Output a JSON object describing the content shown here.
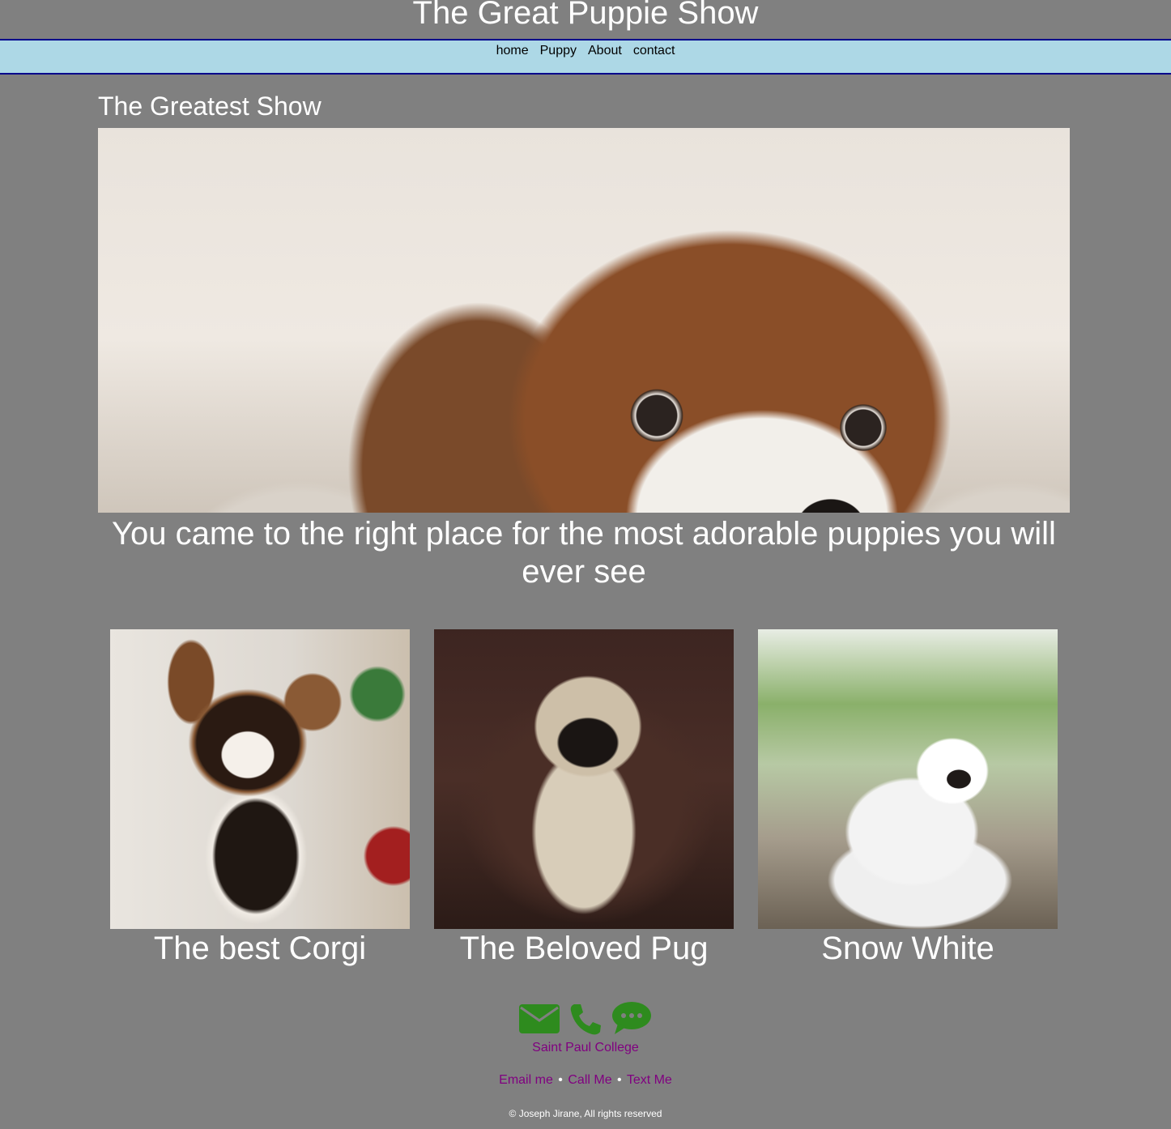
{
  "header": {
    "title": "The Great Puppie Show"
  },
  "nav": {
    "items": [
      {
        "label": "home"
      },
      {
        "label": "Puppy"
      },
      {
        "label": "About"
      },
      {
        "label": "contact"
      }
    ]
  },
  "main": {
    "heading": "The Greatest Show",
    "hero_caption": "You came to the right place for the most adorable puppies you will ever see",
    "cards": [
      {
        "caption": "The best Corgi"
      },
      {
        "caption": "The Beloved Pug"
      },
      {
        "caption": "Snow White"
      }
    ]
  },
  "footer": {
    "icons": [
      "envelope-icon",
      "phone-icon",
      "chat-bubble-icon"
    ],
    "icon_color": "#2e8b1e",
    "college": "Saint Paul College",
    "links": [
      {
        "label": "Email me"
      },
      {
        "label": "Call Me"
      },
      {
        "label": "Text Me"
      }
    ],
    "separator": "•",
    "copyright": "© Joseph Jirane, All rights reserved"
  },
  "colors": {
    "background": "#808080",
    "nav_background": "#add8e6",
    "nav_border": "#00008b",
    "link": "#800080"
  }
}
